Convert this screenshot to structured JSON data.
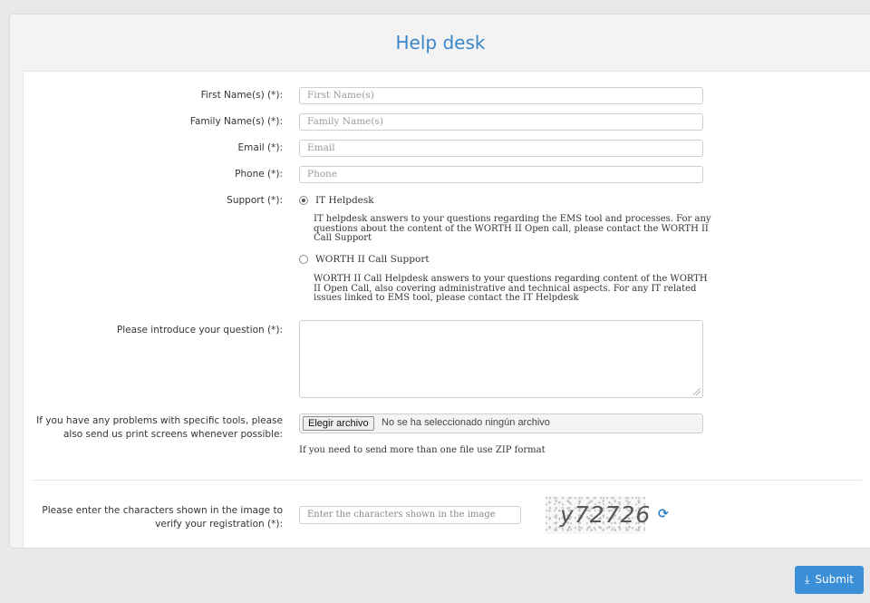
{
  "header": {
    "title": "Help desk"
  },
  "form": {
    "first_name": {
      "label": "First Name(s) (*):",
      "placeholder": "First Name(s)"
    },
    "family_name": {
      "label": "Family Name(s) (*):",
      "placeholder": "Family Name(s)"
    },
    "email": {
      "label": "Email (*):",
      "placeholder": "Email"
    },
    "phone": {
      "label": "Phone (*):",
      "placeholder": "Phone"
    },
    "support": {
      "label": "Support (*):",
      "options": [
        {
          "label": "IT Helpdesk",
          "selected": true,
          "description": "IT helpdesk answers to your questions regarding the EMS tool and processes. For any questions about the content of the WORTH II Open call, please contact the WORTH II Call Support"
        },
        {
          "label": "WORTH II Call Support",
          "selected": false,
          "description": "WORTH II Call Helpdesk answers to your questions regarding content of the WORTH II Open Call, also covering administrative and technical aspects. For any IT related issues linked to EMS tool, please contact the IT Helpdesk"
        }
      ]
    },
    "question": {
      "label": "Please introduce your question (*):",
      "value": ""
    },
    "attachment": {
      "label": "If you have any problems with specific tools, please also send us print screens whenever possible:",
      "button_label": "Elegir archivo",
      "status_text": "No se ha seleccionado ningún archivo",
      "hint": "If you need to send more than one file use ZIP format"
    },
    "captcha": {
      "label": "Please enter the characters shown in the image to verify your registration (*):",
      "placeholder": "Enter the characters shown in the image",
      "image_text": "y72726",
      "refresh_icon": "refresh-icon"
    }
  },
  "actions": {
    "submit_label": "Submit",
    "submit_icon": "download-icon"
  },
  "colors": {
    "accent": "#3b8fd6",
    "title": "#3a86c8",
    "background": "#e8e8e8"
  }
}
